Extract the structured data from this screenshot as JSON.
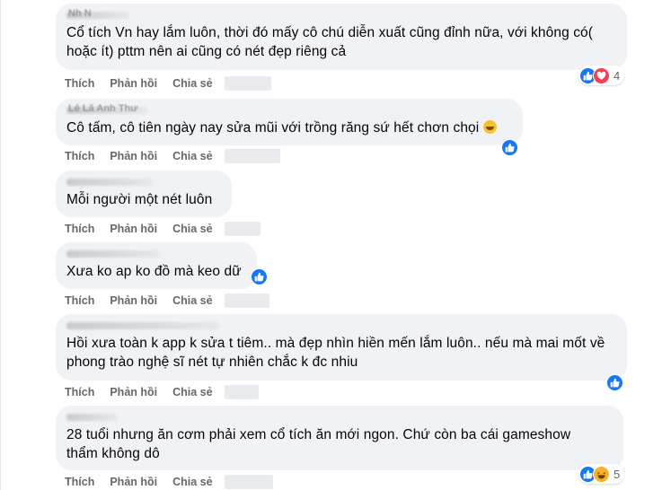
{
  "actions": {
    "like": "Thích",
    "reply": "Phản hồi",
    "share": "Chia sẻ"
  },
  "colors": {
    "bubble": "#f0f2f5",
    "like_blue": "#1877f2",
    "love_red": "#f33e58",
    "haha_yellow": "#f7b125",
    "action_gray": "#65676b"
  },
  "comments": [
    {
      "author": "Nh N",
      "text": "Cổ tích Vn hay lắm luôn, thời đó mấy cô chú diễn xuất cũng đỉnh nữa, với không có( hoặc ít) pttm nên ai cũng có nét đẹp riêng cả",
      "reactions": [
        "like-icon",
        "love-icon"
      ],
      "reaction_count": "4"
    },
    {
      "author": "Lê Lã Anh Thư",
      "text": "Cô tấm, cô tiên ngày nay sửa mũi với trồng răng sứ hết chơn chọi",
      "reactions": [
        "like-icon"
      ],
      "reaction_count": ""
    },
    {
      "author": "",
      "text": "Mỗi người một nét luôn",
      "reactions": [],
      "reaction_count": ""
    },
    {
      "author": "",
      "text": "Xưa ko ap ko đồ mà keo dữ",
      "reactions": [
        "like-icon"
      ],
      "reaction_count": ""
    },
    {
      "author": "",
      "text": "Hồi xưa toàn k app k sửa t tiêm.. mà đẹp nhìn hiền mến lắm luôn.. nếu mà mai mốt về phong trào nghệ sĩ nét tự nhiên chắc k đc nhiu",
      "reactions": [
        "like-icon"
      ],
      "reaction_count": ""
    },
    {
      "author": "",
      "text": "28 tuổi nhưng ăn cơm phải xem cổ tích ăn mới ngon. Chứ còn ba cái gameshow thẩm không dô",
      "reactions": [
        "like-icon",
        "haha-icon"
      ],
      "reaction_count": "5"
    }
  ]
}
